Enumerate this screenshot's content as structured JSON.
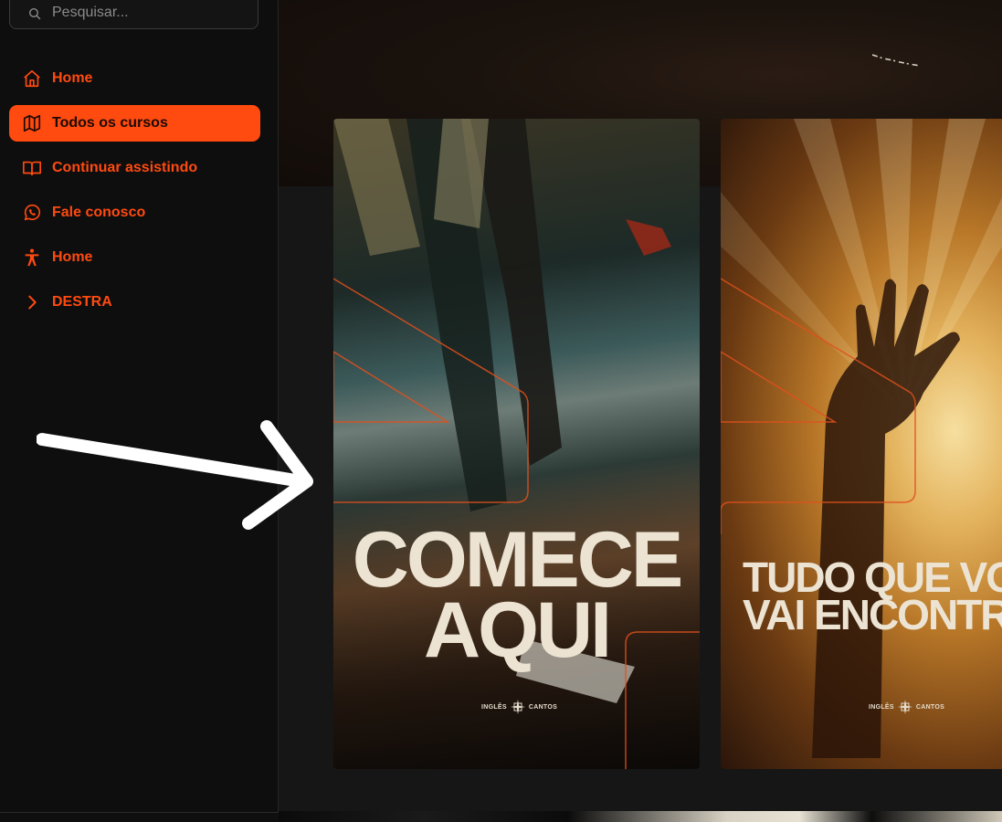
{
  "search": {
    "placeholder": "Pesquisar..."
  },
  "sidebar": {
    "items": [
      {
        "label": "Home",
        "icon": "home-icon",
        "active": false
      },
      {
        "label": "Todos os cursos",
        "icon": "map-icon",
        "active": true
      },
      {
        "label": "Continuar assistindo",
        "icon": "book-open-icon",
        "active": false
      },
      {
        "label": "Fale conosco",
        "icon": "whatsapp-icon",
        "active": false
      },
      {
        "label": "Home",
        "icon": "accessibility-icon",
        "active": false
      },
      {
        "label": "DESTRA",
        "icon": "chevron-right-icon",
        "active": false
      }
    ]
  },
  "cards": [
    {
      "title_line1": "COMECE",
      "title_line2": "AQUI",
      "brand_left": "INGLÊS",
      "brand_right": "CANTOS"
    },
    {
      "title_line1": "TUDO QUE VO",
      "title_line2": "VAI ENCONTR",
      "brand_left": "INGLÊS",
      "brand_right": "CANTOS"
    }
  ],
  "colors": {
    "accent": "#ff4a10",
    "sidebar_bg": "#0e0e0e",
    "title_text": "#ece3d2"
  },
  "annotation": {
    "icon": "arrow-right-icon",
    "color": "#ffffff"
  }
}
